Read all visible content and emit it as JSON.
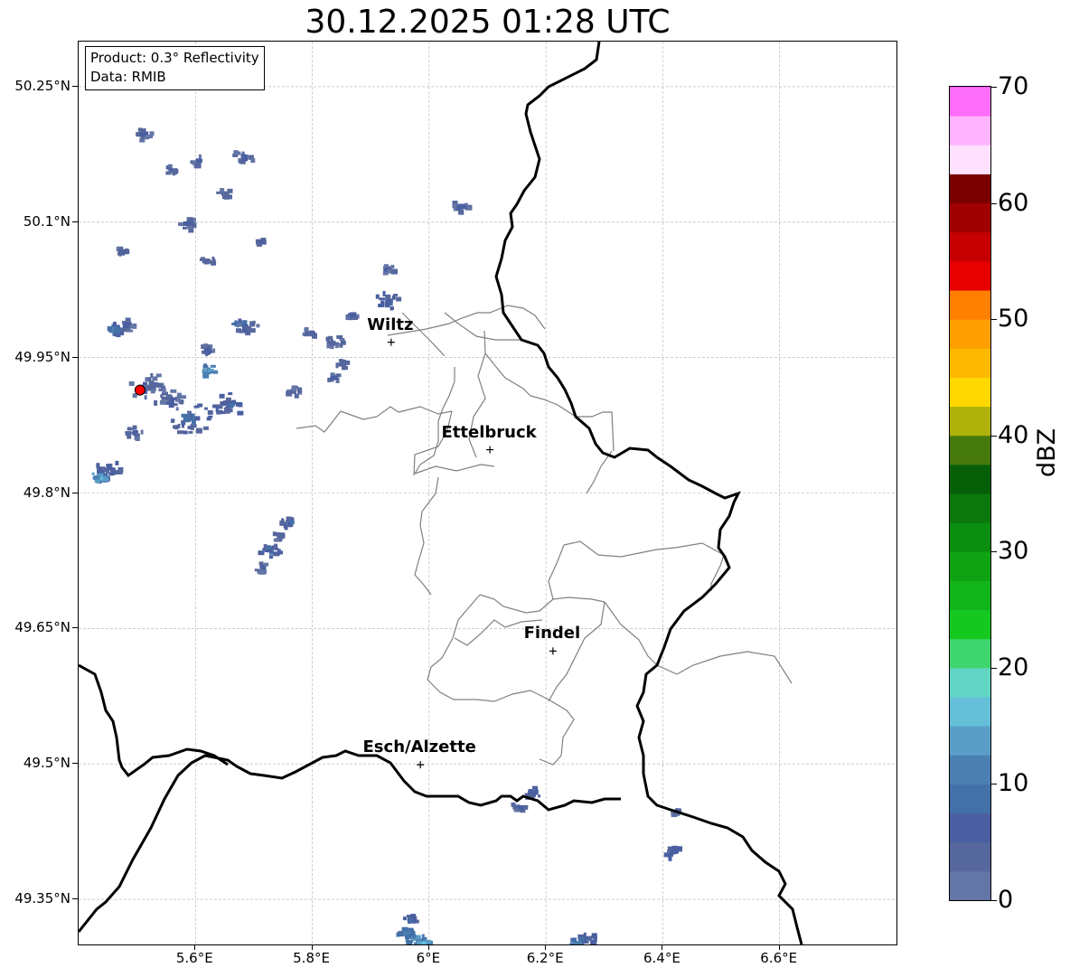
{
  "title": "30.12.2025 01:28 UTC",
  "info": {
    "product": "Product: 0.3° Reflectivity",
    "source": "Data: RMIB"
  },
  "lat_labels": [
    "50.25°N",
    "50.1°N",
    "49.95°N",
    "49.8°N",
    "49.65°N",
    "49.5°N",
    "49.35°N"
  ],
  "lon_labels": [
    "5.6°E",
    "5.8°E",
    "6°E",
    "6.2°E",
    "6.4°E",
    "6.6°E"
  ],
  "cities": [
    {
      "name": "Wiltz",
      "lon": 5.935,
      "lat": 49.967
    },
    {
      "name": "Ettelbruck",
      "lon": 6.104,
      "lat": 49.848
    },
    {
      "name": "Findel",
      "lon": 6.212,
      "lat": 49.625
    },
    {
      "name": "Esch/Alzette",
      "lon": 5.985,
      "lat": 49.499
    }
  ],
  "colorbar": {
    "label": "dBZ",
    "ticks": [
      "0",
      "10",
      "20",
      "30",
      "40",
      "50",
      "60",
      "70"
    ],
    "min": 0,
    "max": 70,
    "step": 2.5,
    "colors": [
      "#6476a6",
      "#56679d",
      "#4a5fa1",
      "#4470a8",
      "#4b7fb2",
      "#5a9ec7",
      "#65bfd9",
      "#63d5c4",
      "#3fd670",
      "#15c820",
      "#11b519",
      "#0fa313",
      "#0a8f10",
      "#0a780c",
      "#065f07",
      "#477a0e",
      "#afb20a",
      "#ffd800",
      "#fdb800",
      "#ff9f00",
      "#ff8000",
      "#e60000",
      "#c60000",
      "#a00000",
      "#7a0000",
      "#ffe0ff",
      "#ffb4ff",
      "#ff6efb",
      "#ee38ee"
    ]
  },
  "map": {
    "lon_range": [
      5.4,
      6.8
    ],
    "lat_range": [
      49.3,
      50.3
    ],
    "grid_lons": [
      5.6,
      5.8,
      6.0,
      6.2,
      6.4,
      6.6
    ],
    "grid_lats": [
      49.35,
      49.5,
      49.65,
      49.8,
      49.95,
      50.1,
      50.25
    ],
    "country_border_color": "#000000",
    "canton_border_color": "#808080",
    "radar_site_color": "#ff0000",
    "radar_site": {
      "lon": 5.505,
      "lat": 49.914
    }
  }
}
